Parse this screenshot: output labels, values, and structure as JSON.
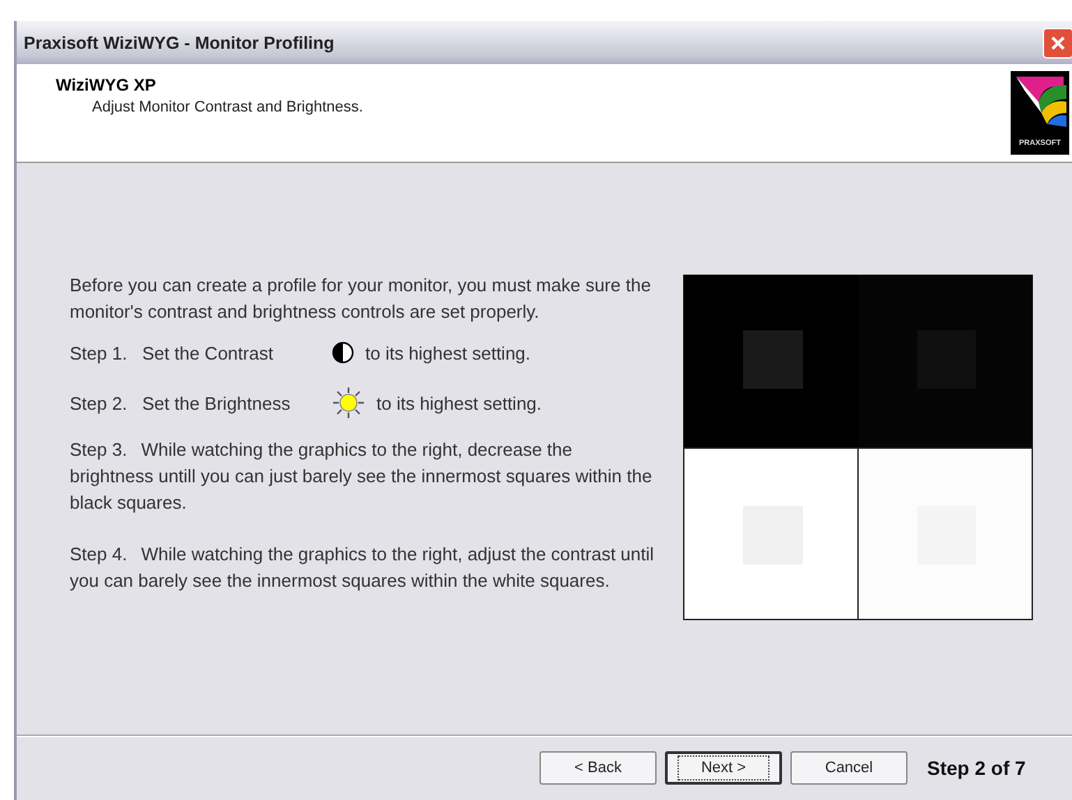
{
  "window": {
    "title": "Praxisoft WiziWYG - Monitor Profiling"
  },
  "header": {
    "title": "WiziWYG XP",
    "subtitle": "Adjust Monitor Contrast and Brightness.",
    "logo_text": "PRAXSOFT"
  },
  "intro": "Before you can create a profile for your monitor, you must make sure the monitor's contrast and brightness controls are set properly.",
  "steps": [
    {
      "kind": "contrast",
      "number": "Step 1.",
      "action": "Set the Contrast",
      "suffix": "to its highest setting."
    },
    {
      "kind": "brightness",
      "number": "Step 2.",
      "action": "Set the Brightness",
      "suffix": "to its highest setting."
    },
    {
      "kind": "paragraph",
      "number": "Step 3.",
      "text": "While watching the graphics to the right, decrease the brightness untill you can just barely see the innermost squares within the black squares."
    },
    {
      "kind": "paragraph",
      "number": "Step 4.",
      "text": "While watching the graphics to the right, adjust the contrast until you can barely see the innermost squares within the white squares."
    }
  ],
  "buttons": [
    {
      "label": "< Back",
      "default": false
    },
    {
      "label": "Next >",
      "default": true
    },
    {
      "label": "Cancel",
      "default": false
    }
  ],
  "step_counter": "Step 2 of 7"
}
